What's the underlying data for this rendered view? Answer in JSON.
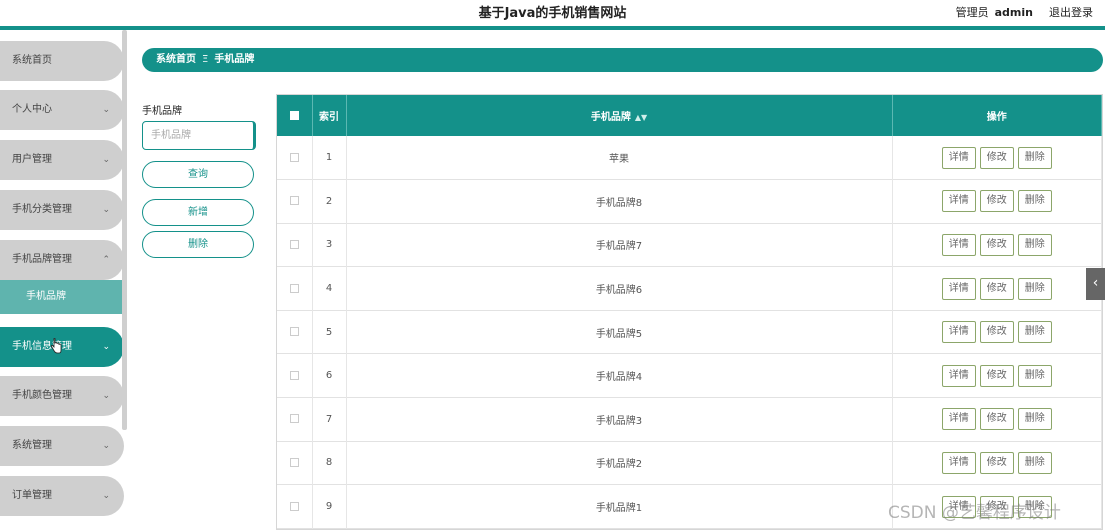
{
  "header": {
    "title": "基于Java的手机销售网站",
    "role_label": "管理员",
    "username": "admin",
    "logout_label": "退出登录"
  },
  "sidebar": {
    "items": [
      {
        "label": "系统首页"
      },
      {
        "label": "个人中心"
      },
      {
        "label": "用户管理"
      },
      {
        "label": "手机分类管理"
      },
      {
        "label": "手机品牌管理"
      },
      {
        "label": "手机信息管理"
      },
      {
        "label": "手机颜色管理"
      },
      {
        "label": "系统管理"
      },
      {
        "label": "订单管理"
      }
    ],
    "submenu_label": "手机品牌",
    "expanded_index": 4,
    "highlighted_index": 5
  },
  "breadcrumb": {
    "home": "系统首页",
    "separator": "Ξ",
    "current": "手机品牌"
  },
  "search": {
    "label": "手机品牌",
    "placeholder": "手机品牌",
    "query_button": "查询",
    "add_button": "新增",
    "delete_button": "删除"
  },
  "table": {
    "headers": {
      "index": "索引",
      "brand": "手机品牌",
      "actions": "操作"
    },
    "rows": [
      {
        "index": "1",
        "brand": "苹果"
      },
      {
        "index": "2",
        "brand": "手机品牌8"
      },
      {
        "index": "3",
        "brand": "手机品牌7"
      },
      {
        "index": "4",
        "brand": "手机品牌6"
      },
      {
        "index": "5",
        "brand": "手机品牌5"
      },
      {
        "index": "6",
        "brand": "手机品牌4"
      },
      {
        "index": "7",
        "brand": "手机品牌3"
      },
      {
        "index": "8",
        "brand": "手机品牌2"
      },
      {
        "index": "9",
        "brand": "手机品牌1"
      }
    ],
    "action_labels": {
      "detail": "详情",
      "edit": "修改",
      "delete": "删除"
    }
  },
  "watermark": "CSDN @艺馨程序设计",
  "colors": {
    "accent": "#14918a",
    "sidebar_item": "#cfcfcf",
    "submenu": "#5fb4ae"
  }
}
